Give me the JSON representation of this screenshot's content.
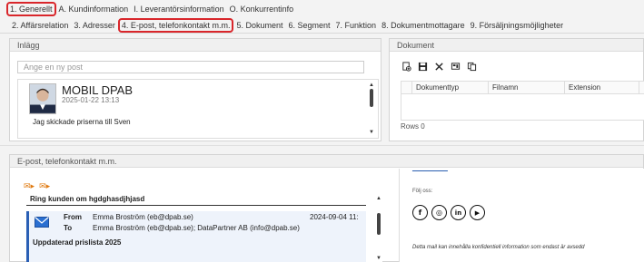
{
  "tabs_row1": [
    {
      "label": "1. Generellt",
      "circled": true
    },
    {
      "label": "A. Kundinformation",
      "circled": false
    },
    {
      "label": "I. Leverantörsinformation",
      "circled": false
    },
    {
      "label": "O. Konkurrentinfo",
      "circled": false
    }
  ],
  "tabs_row2": [
    {
      "label": "2. Affärsrelation",
      "circled": false
    },
    {
      "label": "3. Adresser",
      "circled": false
    },
    {
      "label": "4. E-post, telefonkontakt m.m.",
      "circled": true
    },
    {
      "label": "5. Dokument",
      "circled": false
    },
    {
      "label": "6. Segment",
      "circled": false
    },
    {
      "label": "7. Funktion",
      "circled": false
    },
    {
      "label": "8. Dokumentmottagare",
      "circled": false
    },
    {
      "label": "9. Försäljningsmöjligheter",
      "circled": false
    }
  ],
  "inlagg": {
    "title": "Inlägg",
    "new_post_placeholder": "Ange en ny post",
    "post": {
      "title": "MOBIL DPAB",
      "date": "2025-01-22 13:13",
      "text": "Jag skickade priserna till Sven"
    }
  },
  "dokument": {
    "title": "Dokument",
    "toolbar_icons": [
      "add-document-icon",
      "save-icon",
      "delete-icon",
      "scan-icon",
      "copy-icon"
    ],
    "columns": [
      "Dokumenttyp",
      "Filnamn",
      "Extension"
    ],
    "rows_label": "Rows 0"
  },
  "epost": {
    "title": "E-post, telefonkontakt m.m.",
    "email1_subject": "Ring kunden om hgdghasdjhjasd",
    "email2": {
      "from_label": "From",
      "from_value": "Emma Broström (eb@dpab.se)",
      "date": "2024-09-04 11:",
      "to_label": "To",
      "to_value": "Emma Broström (eb@dpab.se); DataPartner AB (info@dpab.se)",
      "subject": "Uppdaterad prislista 2025"
    },
    "preview": {
      "folj": "Följ oss:",
      "socials": [
        "f",
        "◎",
        "in",
        "▶"
      ],
      "disclaimer": "Detta mail kan innehålla konfidentiell information som endast är avsedd"
    }
  },
  "colors": {
    "accent_red": "#d9262b",
    "accent_blue": "#2a5fb5",
    "icon_orange": "#e07a10"
  }
}
